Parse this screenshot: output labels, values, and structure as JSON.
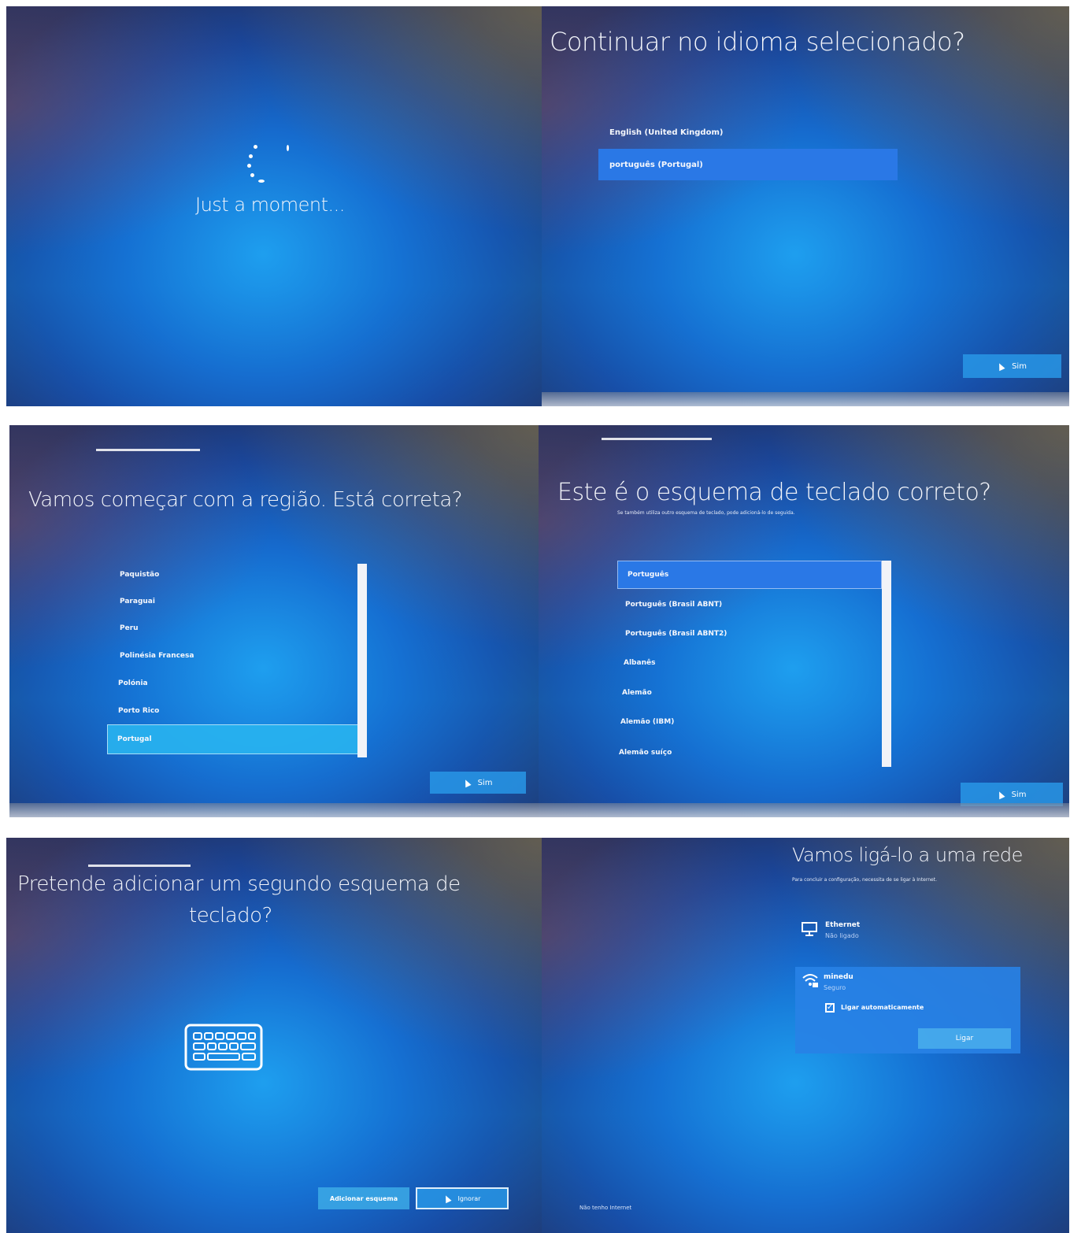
{
  "panel1": {
    "status_text": "Just a moment..."
  },
  "panel2": {
    "title": "Continuar no idioma selecionado?",
    "options": [
      "English (United Kingdom)",
      "português (Portugal)"
    ],
    "selected_index": 1,
    "yes_button": "Sim"
  },
  "panel3": {
    "title": "Vamos começar com a região. Está correta?",
    "regions": [
      "Paquistão",
      "Paraguai",
      "Peru",
      "Polinésia Francesa",
      "Polónia",
      "Porto Rico",
      "Portugal"
    ],
    "selected_index": 6,
    "yes_button": "Sim"
  },
  "panel4": {
    "title": "Este é o esquema de teclado correto?",
    "subtitle": "Se também utiliza outro esquema de teclado, pode adicioná-lo de seguida.",
    "layouts": [
      "Português",
      "Português (Brasil ABNT)",
      "Português (Brasil ABNT2)",
      "Albanês",
      "Alemão",
      "Alemão (IBM)",
      "Alemão suíço"
    ],
    "selected_index": 0,
    "yes_button": "Sim"
  },
  "panel5": {
    "title_line1": "Pretende adicionar um segundo esquema de",
    "title_line2": "teclado?",
    "icon": "keyboard-icon",
    "add_button": "Adicionar esquema",
    "skip_button": "Ignorar"
  },
  "panel6": {
    "title": "Vamos ligá-lo a uma rede",
    "subtitle": "Para concluir a configuração, necessita de se ligar à Internet.",
    "networks": [
      {
        "name": "Ethernet",
        "status": "Não ligado",
        "icon": "ethernet-icon"
      },
      {
        "name": "minedu",
        "status": "Seguro",
        "icon": "wifi-secure-icon"
      }
    ],
    "auto_connect_label": "Ligar automaticamente",
    "auto_connect_checked": true,
    "connect_button": "Ligar",
    "no_internet_link": "Não tenho Internet"
  }
}
